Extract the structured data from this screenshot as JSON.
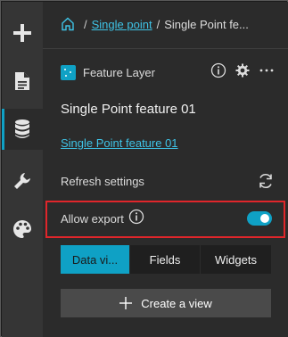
{
  "rail": {
    "items": [
      {
        "icon": "plus-icon",
        "active": false
      },
      {
        "icon": "document-icon",
        "active": false
      },
      {
        "icon": "database-icon",
        "active": true
      },
      {
        "icon": "wrench-icon",
        "active": false
      },
      {
        "icon": "palette-icon",
        "active": false
      }
    ]
  },
  "breadcrumb": {
    "home_icon": "home-icon",
    "separator": "/",
    "link": "Single point",
    "current": "Single Point fe..."
  },
  "layer": {
    "type_label": "Feature Layer",
    "actions": [
      "info-icon",
      "gear-icon",
      "more-icon"
    ]
  },
  "feature": {
    "title": "Single Point feature 01",
    "link": "Single Point feature 01"
  },
  "refresh": {
    "label": "Refresh settings",
    "icon": "refresh-icon"
  },
  "export": {
    "label": "Allow export",
    "enabled": true
  },
  "tabs": [
    {
      "label": "Data vi...",
      "active": true
    },
    {
      "label": "Fields",
      "active": false
    },
    {
      "label": "Widgets",
      "active": false
    }
  ],
  "create_view": {
    "label": "Create a view"
  },
  "colors": {
    "accent": "#0fa1c5",
    "link": "#3ec3e6",
    "highlight_border": "#e0262b",
    "rail_bg": "#353535",
    "panel_bg": "#2b2b2b"
  }
}
